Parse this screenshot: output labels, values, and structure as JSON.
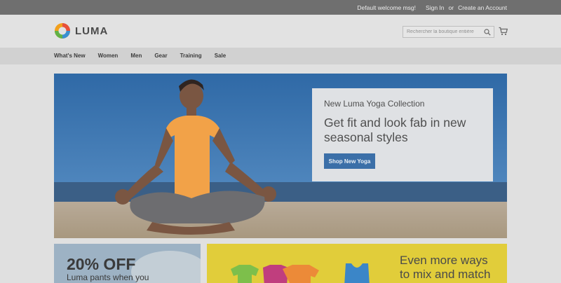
{
  "topbar": {
    "welcome": "Default welcome msg!",
    "sign_in": "Sign In",
    "or": "or",
    "create_account": "Create an Account"
  },
  "header": {
    "logo_text": "LUMA",
    "search_placeholder": "Rechercher la boutique entière",
    "icons": {
      "search": "search-icon",
      "cart": "cart-icon"
    }
  },
  "nav": {
    "items": [
      "What's New",
      "Women",
      "Men",
      "Gear",
      "Training",
      "Sale"
    ]
  },
  "hero": {
    "subtitle": "New Luma Yoga Collection",
    "headline": "Get fit and look fab in new seasonal styles",
    "button_label": "Shop New Yoga"
  },
  "promos": {
    "left": {
      "big": "20% OFF",
      "small": "Luma pants when you"
    },
    "right": {
      "line1": "Even more ways",
      "line2": "to mix and match"
    }
  },
  "colors": {
    "topbar": "#6f6f6f",
    "accent_button": "#3b6fa8",
    "promo_yellow": "#e1cd3a",
    "nav_bg": "#d1d1d1"
  }
}
